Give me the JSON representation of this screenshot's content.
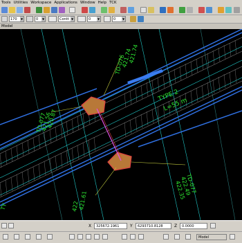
{
  "menu": [
    "Tools",
    "Utilities",
    "Workspace",
    "Applications",
    "Window",
    "Help",
    "TCK"
  ],
  "toolbar": {
    "level_combo": "170",
    "color_combo": "0",
    "style_combo": "Contt",
    "weight_combo": "0",
    "tool_icons": [
      "save-icon",
      "print-icon",
      "undo-icon",
      "redo-icon",
      "zoom-icon",
      "fit-icon",
      "pan-icon",
      "rotate-icon",
      "layer-icon",
      "reference-icon",
      "raster-icon",
      "measure-icon",
      "help-icon"
    ]
  },
  "view": {
    "title": "Model",
    "labels": {
      "type2": "TYPE 2",
      "type2_len": "L=55 m",
      "td076": "TD-076",
      "v421_74a": "421.74",
      "v421_74b": "421.74",
      "td077_left": "TD-077",
      "v420_87": "420.87",
      "v421_56": "421.56",
      "td077_right": "TD-077",
      "v422_49": "422.49",
      "v422_35": "422.35",
      "v422_left": "422",
      "v421_61": "421.61",
      "ty_text": "TY"
    },
    "colors": {
      "background": "#000000",
      "road_blue": "#2f6fe0",
      "hatch_gray": "#9a9a9a",
      "label_green": "#2ee832",
      "cyan_lines": "#20c8c8",
      "red_feature": "#e04040"
    }
  },
  "status": {
    "x_label": "X",
    "x_value": "325672.1961",
    "y_label": "Y",
    "y_value": "6293710.8128",
    "z_label": "Z",
    "z_value": "0.0000"
  },
  "bottom": {
    "model_tab": "Model"
  }
}
